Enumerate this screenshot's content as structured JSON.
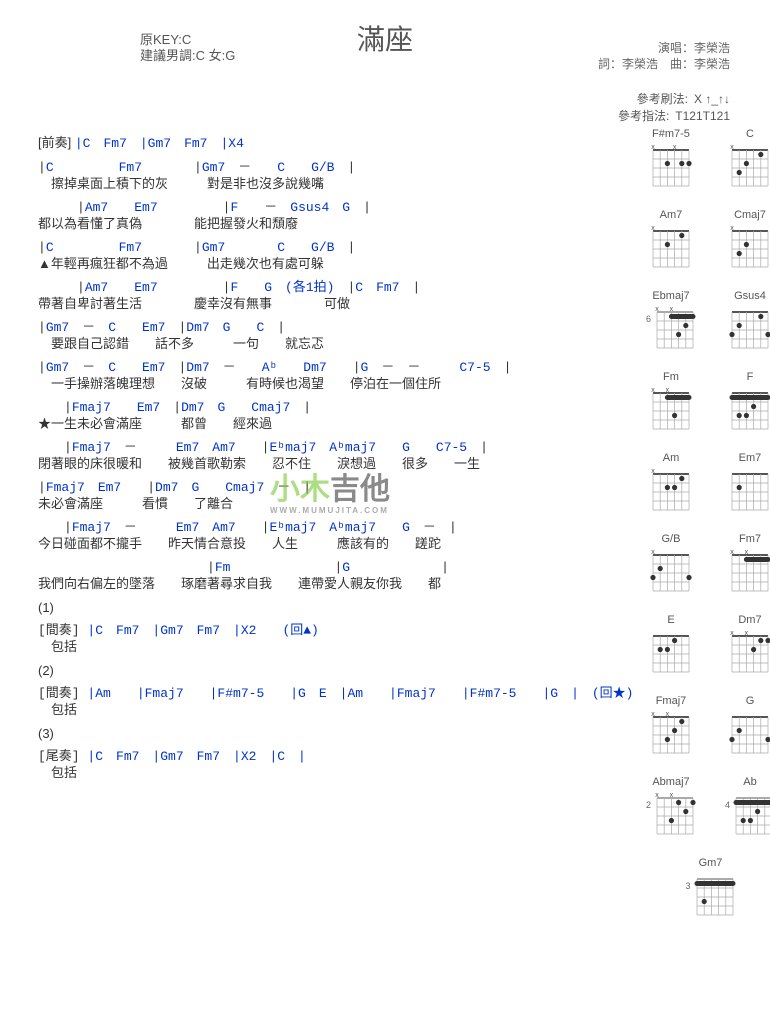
{
  "header": {
    "title": "滿座",
    "key_line1": "原KEY:C",
    "key_line2": "建議男調:C 女:G",
    "credit1": "演唱：李榮浩",
    "credit2": "詞：李榮浩　曲：李榮浩"
  },
  "reference": {
    "strum_label": "參考刷法:",
    "strum_pattern": "X ↑_↑↓",
    "pick_label": "參考指法:",
    "pick_pattern": "T121T121"
  },
  "intro_label": "[前奏]",
  "intro_chords": "|C　Fm7　|Gm7　Fm7　|X4",
  "verse": [
    {
      "chords": "|C　　　　　Fm7　　　　|Gm7　－　　C　　G/B　|",
      "lyrics": "　擦掉桌面上積下的灰　　　對是非也沒多說幾嘴"
    },
    {
      "chords": "　　　|Am7　　Em7　　　　　|F　　－　Gsus4　G　|",
      "lyrics": "都以為看懂了真偽　　　　能把握發火和頹廢"
    },
    {
      "chords": "|C　　　　　Fm7　　　　|Gm7　　　　C　　G/B　|",
      "lyrics": "▲年輕再瘋狂都不為過　　　出走幾次也有處可躲"
    },
    {
      "chords": "　　　|Am7　　Em7　　　　　|F　　G　(各1拍)　|C　Fm7　|",
      "lyrics": "帶著自卑討著生活　　　　慶幸沒有無事　　　　可做"
    },
    {
      "chords": "|Gm7　－　C　　Em7　|Dm7　G　　C　|",
      "lyrics": "　要跟自己認錯　　話不多　　　一句　　就忘忑"
    },
    {
      "chords": "|Gm7　－　C　　Em7　|Dm7　－　　Aᵇ　　Dm7　　|G　－　－　　　C7-5　|",
      "lyrics": "　一手操辦落魄理想　　沒破　　　有時候也渴望　　停泊在一個住所"
    }
  ],
  "chorus": [
    {
      "chords": "　　|Fmaj7　　Em7　|Dm7　G　　Cmaj7　|",
      "lyrics": "★一生未必會滿座　　　都曾　　經來過"
    },
    {
      "chords": "　　|Fmaj7　－　　　Em7　Am7　　|Eᵇmaj7　Aᵇmaj7　　G　　C7-5　|",
      "lyrics": "閉著眼的床很暖和　　被幾首歌勒索　　忍不住　　淚想過　　很多　　一生"
    },
    {
      "chords": "|Fmaj7　Em7　　|Dm7　G　　Cmaj7　－　|",
      "lyrics": "未必會滿座　　　看慣　　了離合"
    },
    {
      "chords": "　　|Fmaj7　－　　　Em7　Am7　　|Eᵇmaj7　Aᵇmaj7　　G　－　|",
      "lyrics": "今日碰面都不攏手　　昨天情合意投　　人生　　　應該有的　　蹉跎"
    },
    {
      "chords": "　　　　　　　　　　　　　|Fm　　　　　　　　|G　　　　　　　|",
      "lyrics": "我們向右偏左的墜落　　琢磨著尋求自我　　連帶愛人親友你我　　都"
    }
  ],
  "interlude1": {
    "num": "(1)",
    "label": "[間奏]",
    "chords": "|C　Fm7　|Gm7　Fm7　|X2　　(回▲)",
    "lyrics": "　包括"
  },
  "interlude2": {
    "num": "(2)",
    "label": "[間奏]",
    "chords": "|Am　　|Fmaj7　　|F#m7-5　　|G　E　|Am　　|Fmaj7　　|F#m7-5　　|G　|　(回★)",
    "lyrics": "　包括"
  },
  "outro": {
    "num": "(3)",
    "label": "[尾奏]",
    "chords": "|C　Fm7　|Gm7　Fm7　|X2　|C　|",
    "lyrics": "　包括"
  },
  "chart_data": {
    "type": "chord-diagrams",
    "diagrams": [
      {
        "name": "F#m7-5",
        "fret": "",
        "muted": "x  x",
        "dots": [
          [
            2,
            1
          ],
          [
            2,
            2
          ],
          [
            2,
            4
          ]
        ],
        "open": [
          3,
          5,
          6
        ]
      },
      {
        "name": "C",
        "fret": "",
        "muted": "x",
        "dots": [
          [
            1,
            2
          ],
          [
            2,
            4
          ],
          [
            3,
            5
          ]
        ],
        "open": [
          1,
          3,
          6
        ]
      },
      {
        "name": "Am7",
        "fret": "",
        "muted": "x",
        "dots": [
          [
            1,
            2
          ],
          [
            2,
            4
          ]
        ],
        "open": [
          1,
          3,
          5,
          6
        ]
      },
      {
        "name": "Cmaj7",
        "fret": "",
        "muted": "x",
        "dots": [
          [
            2,
            4
          ],
          [
            3,
            5
          ]
        ],
        "open": [
          1,
          2,
          3,
          6
        ]
      },
      {
        "name": "Ebmaj7",
        "fret": "6",
        "muted": "x x",
        "barre": [
          1,
          1,
          4
        ],
        "dots": [
          [
            2,
            2
          ],
          [
            3,
            3
          ]
        ]
      },
      {
        "name": "Gsus4",
        "fret": "",
        "muted": "",
        "dots": [
          [
            1,
            2
          ],
          [
            2,
            5
          ],
          [
            3,
            1
          ],
          [
            3,
            6
          ]
        ],
        "open": [
          3,
          4
        ]
      },
      {
        "name": "Fm",
        "fret": "",
        "muted": "x x",
        "barre": [
          1,
          1,
          4
        ],
        "dots": [
          [
            3,
            3
          ]
        ]
      },
      {
        "name": "F",
        "fret": "",
        "muted": "",
        "barre": [
          1,
          1,
          6
        ],
        "dots": [
          [
            2,
            3
          ],
          [
            3,
            4
          ],
          [
            3,
            5
          ]
        ]
      },
      {
        "name": "Am",
        "fret": "",
        "muted": "x",
        "dots": [
          [
            1,
            2
          ],
          [
            2,
            3
          ],
          [
            2,
            4
          ]
        ],
        "open": [
          1,
          5,
          6
        ]
      },
      {
        "name": "Em7",
        "fret": "",
        "muted": "",
        "dots": [
          [
            2,
            5
          ]
        ],
        "open": [
          1,
          2,
          3,
          4,
          6
        ]
      },
      {
        "name": "G/B",
        "fret": "",
        "muted": "x",
        "dots": [
          [
            2,
            5
          ],
          [
            3,
            1
          ],
          [
            3,
            6
          ]
        ],
        "open": [
          2,
          3,
          4
        ]
      },
      {
        "name": "Fm7",
        "fret": "",
        "muted": "x x",
        "barre": [
          1,
          1,
          4
        ],
        "dots": []
      },
      {
        "name": "E",
        "fret": "",
        "muted": "",
        "dots": [
          [
            1,
            3
          ],
          [
            2,
            4
          ],
          [
            2,
            5
          ]
        ],
        "open": [
          1,
          2,
          6
        ]
      },
      {
        "name": "Dm7",
        "fret": "",
        "muted": "x x",
        "dots": [
          [
            1,
            1
          ],
          [
            1,
            2
          ],
          [
            2,
            3
          ]
        ],
        "open": [
          4
        ]
      },
      {
        "name": "Fmaj7",
        "fret": "",
        "muted": "x x",
        "dots": [
          [
            1,
            2
          ],
          [
            2,
            3
          ],
          [
            3,
            4
          ]
        ],
        "open": [
          1
        ]
      },
      {
        "name": "G",
        "fret": "",
        "muted": "",
        "dots": [
          [
            2,
            5
          ],
          [
            3,
            1
          ],
          [
            3,
            6
          ]
        ],
        "open": [
          2,
          3,
          4
        ]
      },
      {
        "name": "Abmaj7",
        "fret": "2",
        "muted": "x x",
        "dots": [
          [
            1,
            1
          ],
          [
            1,
            3
          ],
          [
            2,
            2
          ],
          [
            3,
            4
          ]
        ]
      },
      {
        "name": "Ab",
        "fret": "4",
        "muted": "",
        "barre": [
          1,
          1,
          6
        ],
        "dots": [
          [
            2,
            3
          ],
          [
            3,
            4
          ],
          [
            3,
            5
          ]
        ]
      },
      {
        "name": "Gm7",
        "fret": "3",
        "muted": "",
        "barre": [
          1,
          1,
          6
        ],
        "dots": [
          [
            3,
            5
          ]
        ]
      }
    ]
  },
  "watermark": {
    "main1": "小木",
    "main2": "吉他",
    "sub": "WWW.MUMUJITA.COM"
  }
}
